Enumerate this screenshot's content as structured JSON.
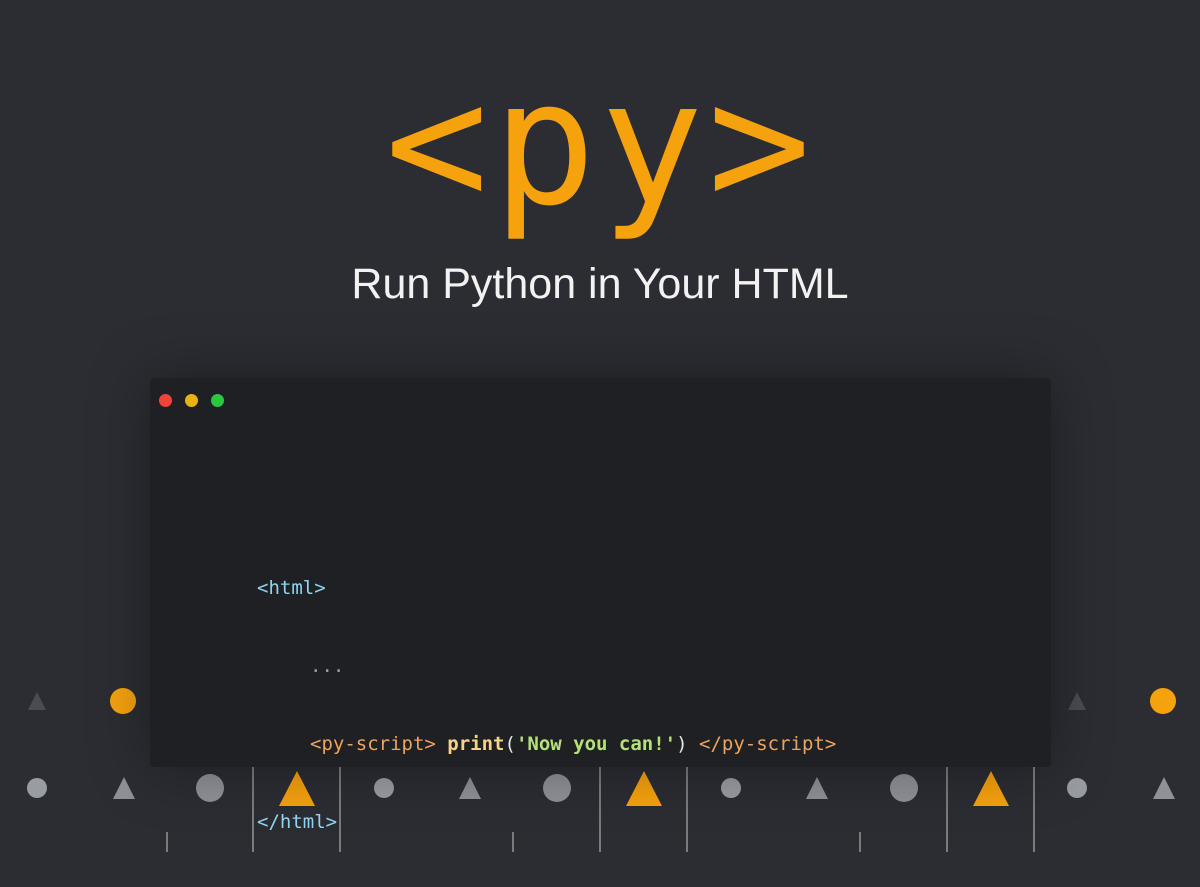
{
  "logo": {
    "text": "<py>"
  },
  "subtitle": "Run Python in Your HTML",
  "window": {
    "controls": [
      "close",
      "minimize",
      "maximize"
    ],
    "code": {
      "line1": "<html>",
      "line2": "...",
      "line3_open": "<py-script>",
      "line3_fn": "print",
      "line3_paren_open": "(",
      "line3_string": "'Now you can!'",
      "line3_paren_close": ")",
      "line3_close": "</py-script>",
      "line4": "</html>"
    }
  },
  "colors": {
    "background": "#2c2d33",
    "accent": "#f6a20d",
    "window_bg": "#1f2024",
    "tag_blue": "#8fd4f0",
    "tag_orange": "#f0a35a",
    "string_green": "#b5e07a",
    "function_yellow": "#f5d38a"
  }
}
